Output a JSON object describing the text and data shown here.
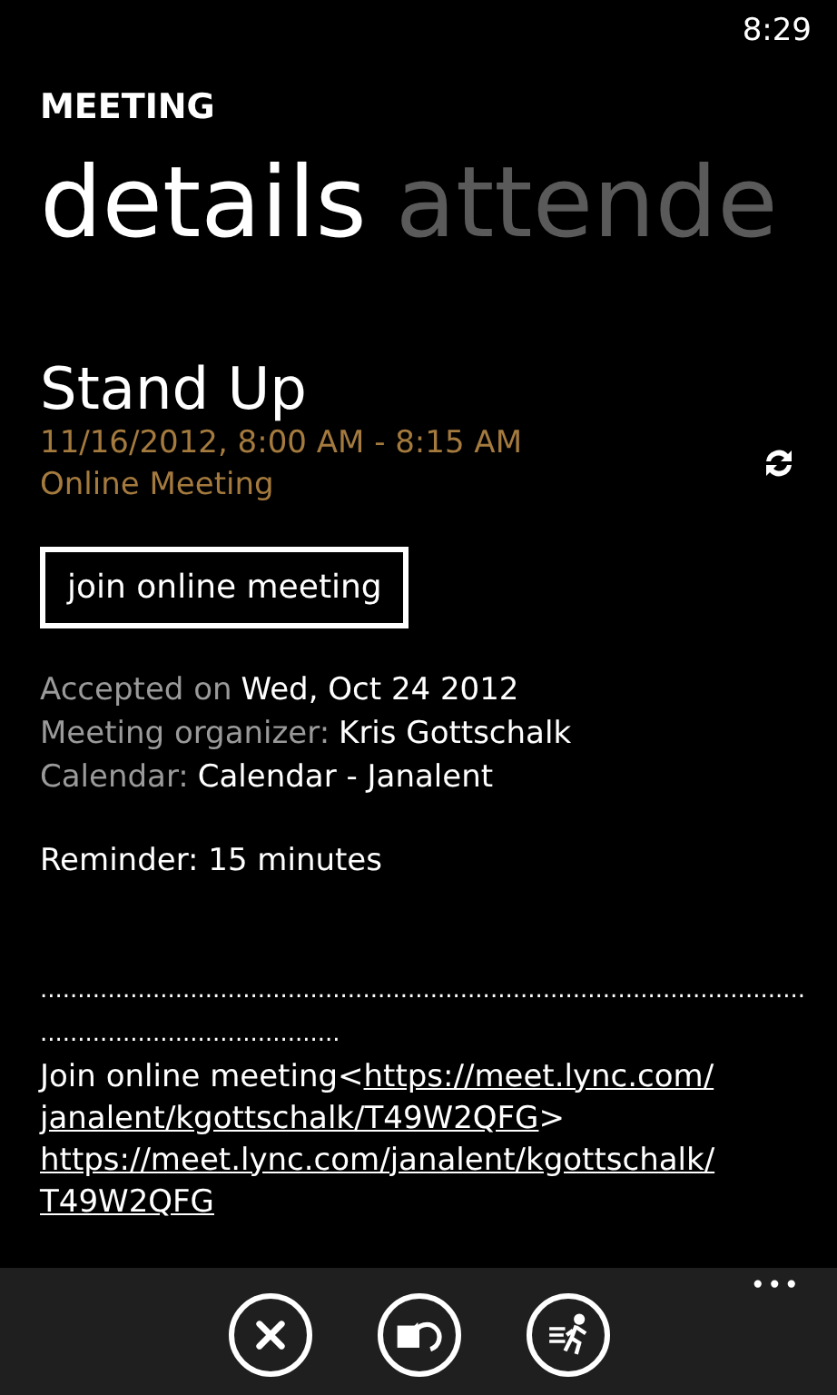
{
  "status_bar": {
    "time": "8:29"
  },
  "app_title": "MEETING",
  "pivots": [
    {
      "label": "details",
      "selected": true
    },
    {
      "label": "attende",
      "selected": false
    }
  ],
  "meeting": {
    "title": "Stand Up",
    "when": "11/16/2012, 8:00 AM - 8:15 AM",
    "location": "Online Meeting"
  },
  "join_button": "join online meeting",
  "info": [
    {
      "label": "Accepted on",
      "value": "Wed, Oct 24 2012"
    },
    {
      "label": "Meeting organizer:",
      "value": "Kris Gottschalk"
    },
    {
      "label": "Calendar:",
      "value": "Calendar - Janalent"
    }
  ],
  "reminder": "Reminder: 15 minutes",
  "body": {
    "dots": [
      "......................................................................................................",
      "........................................"
    ],
    "lines": [
      [
        {
          "text": "Join online meeting<",
          "link": false
        },
        {
          "text": "https://meet.lync.com/",
          "link": true
        }
      ],
      [
        {
          "text": "janalent/kgottschalk/T49W2QFG",
          "link": true
        },
        {
          "text": ">",
          "link": false
        }
      ],
      [
        {
          "text": "https://meet.lync.com/janalent/kgottschalk/",
          "link": true
        }
      ],
      [
        {
          "text": "T49W2QFG",
          "link": true
        }
      ]
    ]
  },
  "app_bar": {
    "buttons": [
      {
        "kind": "decline"
      },
      {
        "kind": "propose"
      },
      {
        "kind": "late"
      }
    ],
    "more": "•••"
  }
}
